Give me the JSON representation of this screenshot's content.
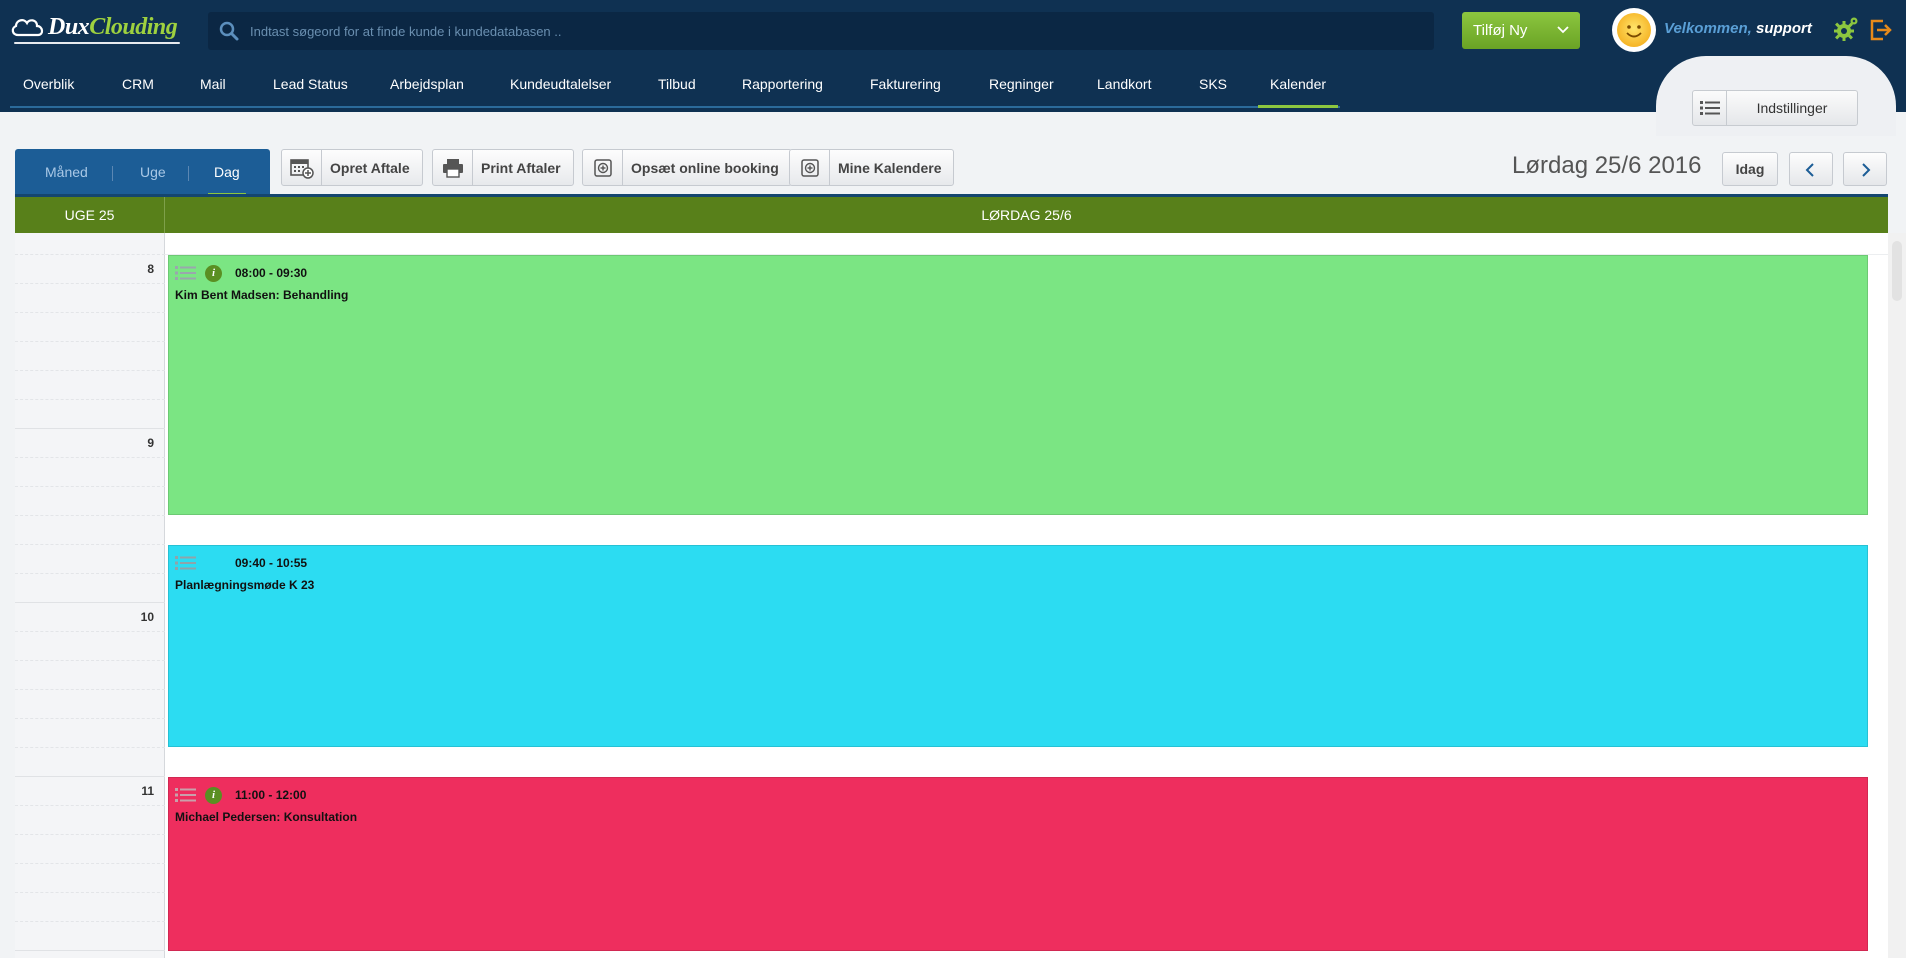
{
  "header": {
    "logo_part1": "Dux",
    "logo_part2": "Clouding",
    "search_placeholder": "Indtast søgeord for at finde kunde i kundedatabasen ..",
    "add_new_label": "Tilføj Ny",
    "welcome_prefix": "Velkommen,",
    "welcome_user": "support"
  },
  "nav": {
    "items": [
      "Overblik",
      "CRM",
      "Mail",
      "Lead Status",
      "Arbejdsplan",
      "Kundeudtalelser",
      "Tilbud",
      "Rapportering",
      "Fakturering",
      "Regninger",
      "Landkort",
      "SKS",
      "Kalender"
    ],
    "active": "Kalender",
    "settings_label": "Indstillinger"
  },
  "toolbar": {
    "views": [
      "Måned",
      "Uge",
      "Dag"
    ],
    "active_view": "Dag",
    "buttons": [
      "Opret Aftale",
      "Print Aftaler",
      "Opsæt online booking",
      "Mine Kalendere"
    ],
    "current_date": "Lørdag 25/6 2016",
    "today_label": "Idag",
    "prev_icon": "chevron-left-icon",
    "next_icon": "chevron-right-icon"
  },
  "calendar": {
    "week_label": "UGE 25",
    "day_label": "LØRDAG 25/6",
    "hours": [
      "8",
      "9",
      "10",
      "11"
    ],
    "events": [
      {
        "time": "08:00 - 09:30",
        "title": "Kim Bent Madsen: Behandling",
        "color": "#7be583",
        "has_info": true
      },
      {
        "time": "09:40 - 10:55",
        "title": "Planlægningsmøde K 23",
        "color": "#2cdcf2",
        "has_info": false
      },
      {
        "time": "11:00 - 12:00",
        "title": "Michael Pedersen: Konsultation",
        "color": "#ee2e5e",
        "has_info": true
      }
    ]
  },
  "colors": {
    "topbar": "#0f3152",
    "accent_green": "#8cc63f",
    "header_green": "#58801a",
    "view_tabs_blue": "#1c5d96"
  }
}
